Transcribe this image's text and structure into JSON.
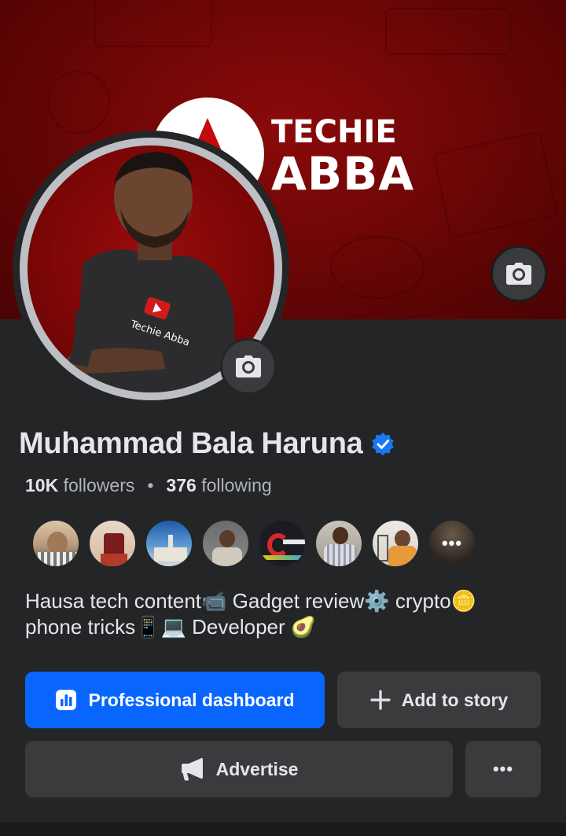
{
  "cover": {
    "brand_line1": "TECHIE",
    "brand_line2": "ABBA",
    "camera_icon": "camera-icon"
  },
  "avatar": {
    "shirt_text": "Techie Abba",
    "camera_icon": "camera-icon"
  },
  "profile": {
    "name": "Muhammad Bala Haruna",
    "verified_icon": "verified-badge-icon",
    "followers_count": "10K",
    "followers_label": "followers",
    "separator": "•",
    "following_count": "376",
    "following_label": "following"
  },
  "friends": {
    "more_label": "•••"
  },
  "bio": {
    "line1": "Hausa tech content📹 Gadget review⚙️ crypto🪙",
    "line2": "phone tricks📱💻 Developer 🥑"
  },
  "actions": {
    "professional_dashboard": "Professional dashboard",
    "add_to_story": "Add to story",
    "advertise": "Advertise",
    "more": "•••"
  },
  "colors": {
    "background": "#242526",
    "primary_button": "#0866ff",
    "secondary_button": "#3a3b3c",
    "cover_red": "#7a0606",
    "verified_blue": "#1877f2"
  }
}
